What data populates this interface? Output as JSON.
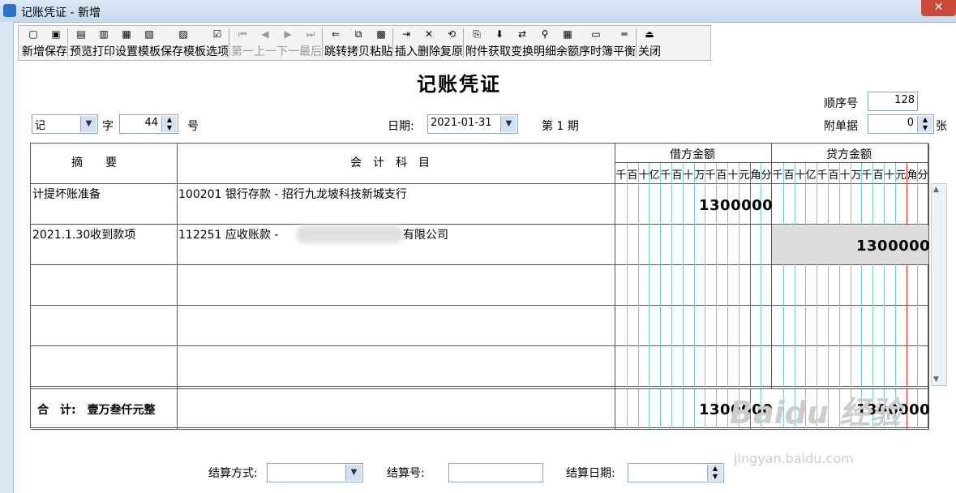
{
  "window": {
    "title": "记账凭证 - 新增",
    "close_label": "✕"
  },
  "toolbar": {
    "buttons": [
      {
        "label": "新增",
        "icon": "new-file-icon",
        "disabled": false
      },
      {
        "label": "保存",
        "icon": "save-icon",
        "disabled": false
      },
      {
        "label": "预览",
        "icon": "preview-icon",
        "disabled": false
      },
      {
        "label": "打印",
        "icon": "print-icon",
        "disabled": false
      },
      {
        "label": "设置",
        "icon": "page-setup-icon",
        "disabled": false
      },
      {
        "label": "模板",
        "icon": "template-icon",
        "disabled": false
      },
      {
        "label": "保存模板",
        "icon": "save-template-icon",
        "disabled": false
      },
      {
        "label": "选项",
        "icon": "options-icon",
        "disabled": false
      },
      {
        "label": "第一",
        "icon": "first-icon",
        "disabled": true
      },
      {
        "label": "上一",
        "icon": "prev-icon",
        "disabled": true
      },
      {
        "label": "下一",
        "icon": "next-icon",
        "disabled": true
      },
      {
        "label": "最后",
        "icon": "last-icon",
        "disabled": true
      },
      {
        "label": "跳转",
        "icon": "jump-icon",
        "disabled": false
      },
      {
        "label": "拷贝",
        "icon": "copy-icon",
        "disabled": false
      },
      {
        "label": "粘贴",
        "icon": "paste-icon",
        "disabled": false
      },
      {
        "label": "插入",
        "icon": "insert-row-icon",
        "disabled": false
      },
      {
        "label": "删除",
        "icon": "delete-row-icon",
        "disabled": false
      },
      {
        "label": "复原",
        "icon": "restore-icon",
        "disabled": false
      },
      {
        "label": "附件",
        "icon": "attachment-icon",
        "disabled": false
      },
      {
        "label": "获取",
        "icon": "fetch-icon",
        "disabled": false
      },
      {
        "label": "变换",
        "icon": "transform-icon",
        "disabled": false
      },
      {
        "label": "明细",
        "icon": "detail-icon",
        "disabled": false
      },
      {
        "label": "余额",
        "icon": "balance-icon",
        "disabled": false
      },
      {
        "label": "序时簿",
        "icon": "journal-icon",
        "disabled": false
      },
      {
        "label": "平衡",
        "icon": "balance-check-icon",
        "disabled": false
      },
      {
        "label": "关闭",
        "icon": "exit-icon",
        "disabled": false
      }
    ]
  },
  "voucher": {
    "title": "记账凭证",
    "seq_label": "顺序号",
    "seq_value": "128",
    "word_value": "记",
    "word_label": "字",
    "number_value": "44",
    "number_label": "号",
    "date_label": "日期:",
    "date_value": "2021-01-31",
    "period_label": "第 1 期",
    "attach_label": "附单据",
    "attach_value": "0",
    "attach_unit": "张"
  },
  "table": {
    "headers": {
      "summary": "摘　　要",
      "account": "会　计　科　目",
      "debit": "借方金额",
      "credit": "贷方金额"
    },
    "digit_units": [
      "千",
      "百",
      "十",
      "亿",
      "千",
      "百",
      "十",
      "万",
      "千",
      "百",
      "十",
      "元",
      "角",
      "分"
    ],
    "rows": [
      {
        "summary": "计提坏账准备",
        "account": "100201 银行存款 - 招行九龙坡科技新城支行",
        "debit": "1300000",
        "credit": ""
      },
      {
        "summary": "2021.1.30收到款项",
        "account": "112251 应收账款 - ",
        "account_tail": "有限公司",
        "debit": "",
        "credit": "1300000"
      },
      {
        "summary": "",
        "account": "",
        "debit": "",
        "credit": ""
      },
      {
        "summary": "",
        "account": "",
        "debit": "",
        "credit": ""
      },
      {
        "summary": "",
        "account": "",
        "debit": "",
        "credit": ""
      }
    ],
    "total_label": "合　计:　壹万叁仟元整",
    "total_debit": "1300000",
    "total_credit": "1300000"
  },
  "settlement": {
    "method_label": "结算方式:",
    "number_label": "结算号:",
    "date_label": "结算日期:"
  },
  "watermark": {
    "main": "Baidu 经验",
    "sub": "jingyan.baidu.com"
  }
}
